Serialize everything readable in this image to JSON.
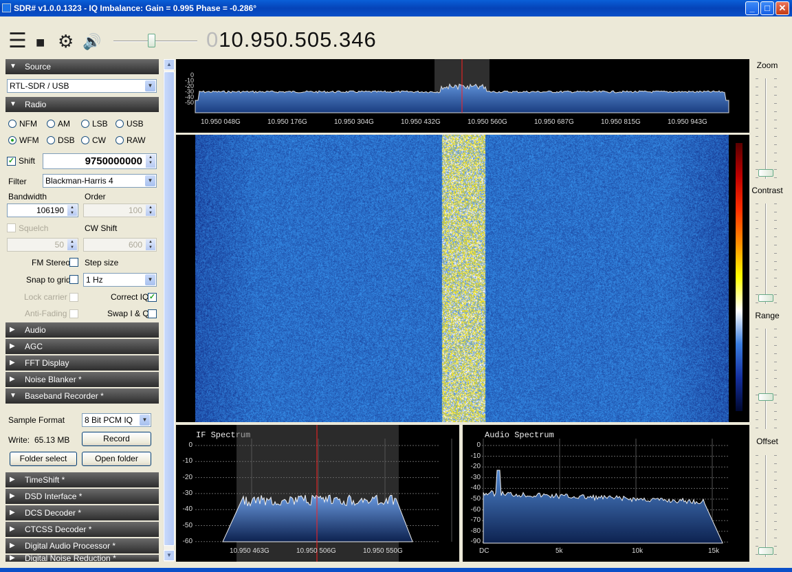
{
  "window": {
    "title": "SDR# v1.0.0.1323 - IQ Imbalance: Gain = 0.995 Phase = -0.286°",
    "minimize": "_",
    "maximize": "□",
    "close": "✕"
  },
  "toolbar": {
    "menu_icon": "☰",
    "stop_icon": "■",
    "settings_icon": "⚙",
    "volume_icon": "🔊",
    "volume_level": 0.45,
    "freq_leading": "0",
    "frequency": "10.950.505.346"
  },
  "left": {
    "source_section": "Source",
    "source_device": "RTL-SDR / USB",
    "radio_section": "Radio",
    "modes": [
      "NFM",
      "AM",
      "LSB",
      "USB",
      "WFM",
      "DSB",
      "CW",
      "RAW"
    ],
    "selected_mode": "WFM",
    "shift_label": "Shift",
    "shift_value": "9750000000",
    "filter_label": "Filter",
    "filter_value": "Blackman-Harris 4",
    "bandwidth_label": "Bandwidth",
    "bandwidth_value": "106190",
    "order_label": "Order",
    "order_value": "100",
    "squelch_label": "Squelch",
    "squelch_value": "50",
    "cwshift_label": "CW Shift",
    "cwshift_value": "600",
    "fm_stereo_label": "FM Stereo",
    "step_size_label": "Step size",
    "snap_label": "Snap to grid",
    "step_value": "1 Hz",
    "lock_carrier_label": "Lock carrier",
    "correct_iq_label": "Correct IQ",
    "anti_fading_label": "Anti-Fading",
    "swap_iq_label": "Swap I & Q",
    "audio_section": "Audio",
    "agc_section": "AGC",
    "fft_section": "FFT Display",
    "noise_blanker_section": "Noise Blanker *",
    "baseband_section": "Baseband Recorder *",
    "sample_format_label": "Sample Format",
    "sample_format_value": "8 Bit PCM IQ",
    "write_label": "Write:",
    "write_value": "65.13 MB",
    "record_button": "Record",
    "folder_select_button": "Folder select",
    "open_folder_button": "Open folder",
    "timeshift_section": "TimeShift *",
    "dsd_section": "DSD Interface *",
    "dcs_section": "DCS Decoder *",
    "ctcss_section": "CTCSS Decoder *",
    "dap_section": "Digital Audio Processor *",
    "dnr_section": "Digital Noise Reduction *",
    "arrow_collapsed": "▶",
    "arrow_expanded": "▼"
  },
  "spectrum": {
    "ylabels": [
      "0",
      "-10",
      "-20",
      "-30",
      "-40",
      "-50"
    ],
    "xlabels": [
      "10.950 048G",
      "10.950 176G",
      "10.950 304G",
      "10.950 432G",
      "10.950 560G",
      "10.950 687G",
      "10.950 815G",
      "10.950 943G"
    ]
  },
  "if_spectrum": {
    "title": "IF Spectrum",
    "ylabels": [
      "0",
      "-10",
      "-20",
      "-30",
      "-40",
      "-50",
      "-60"
    ],
    "xlabels": [
      "10.950 463G",
      "10.950 506G",
      "10.950 550G"
    ]
  },
  "audio_spectrum": {
    "title": "Audio Spectrum",
    "ylabels": [
      "0",
      "-10",
      "-20",
      "-30",
      "-40",
      "-50",
      "-60",
      "-70",
      "-80",
      "-90"
    ],
    "xlabels": [
      "DC",
      "5k",
      "10k",
      "15k"
    ]
  },
  "right": {
    "zoom_label": "Zoom",
    "contrast_label": "Contrast",
    "range_label": "Range",
    "offset_label": "Offset"
  },
  "colors": {
    "panel_bg": "#ece9d8",
    "spectrum_fill": "#1e5aa8",
    "tune_line": "#ff2020",
    "waterfall_bg": "#1d3f9e"
  }
}
